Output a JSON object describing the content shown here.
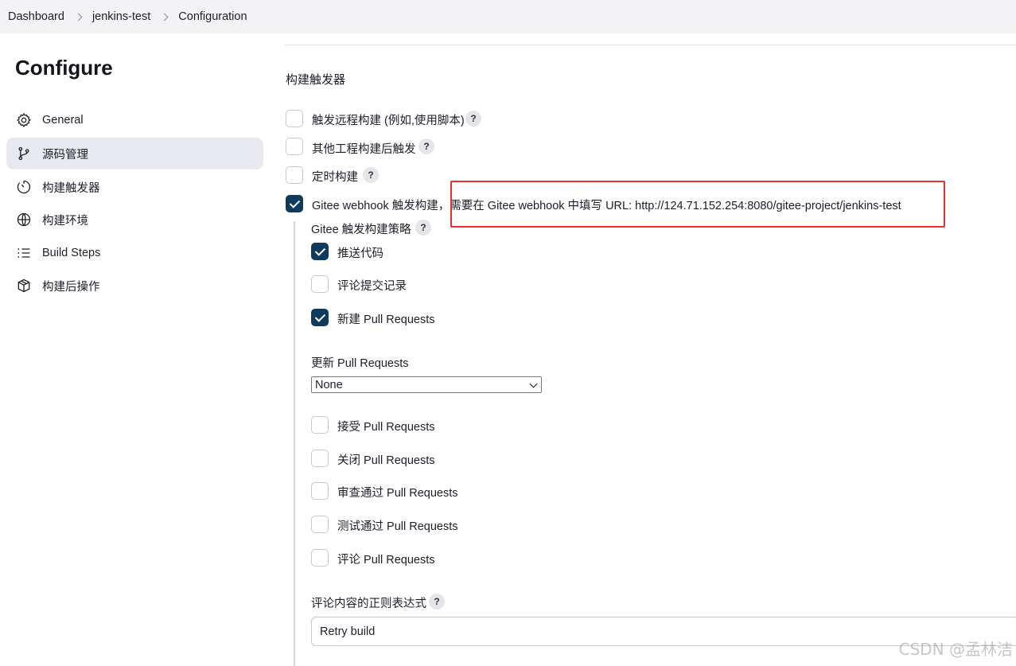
{
  "breadcrumb": {
    "items": [
      "Dashboard",
      "jenkins-test",
      "Configuration"
    ]
  },
  "sidebar": {
    "title": "Configure",
    "items": [
      {
        "label": "General",
        "icon": "gear-icon"
      },
      {
        "label": "源码管理",
        "icon": "branch-icon",
        "active": true
      },
      {
        "label": "构建触发器",
        "icon": "timer-icon"
      },
      {
        "label": "构建环境",
        "icon": "globe-icon"
      },
      {
        "label": "Build Steps",
        "icon": "list-icon"
      },
      {
        "label": "构建后操作",
        "icon": "box-icon"
      }
    ]
  },
  "main": {
    "section_title": "构建触发器",
    "triggers": [
      {
        "label": "触发远程构建 (例如,使用脚本)",
        "checked": false,
        "help": "?"
      },
      {
        "label": "其他工程构建后触发",
        "checked": false,
        "help": "?"
      },
      {
        "label": "定时构建",
        "checked": false,
        "help": "?"
      }
    ],
    "gitee": {
      "label": "Gitee webhook 触发构建，需要在 Gitee webhook 中填写 URL: http://124.71.152.254:8080/gitee-project/jenkins-test",
      "checked": true,
      "strategy_label": "Gitee 触发构建策略",
      "help": "?",
      "options": [
        {
          "label": "推送代码",
          "checked": true
        },
        {
          "label": "评论提交记录",
          "checked": false
        },
        {
          "label": "新建 Pull Requests",
          "checked": true
        }
      ],
      "update_pr_label": "更新 Pull Requests",
      "update_pr_value": "None",
      "pr_options": [
        {
          "label": "接受 Pull Requests",
          "checked": false
        },
        {
          "label": "关闭 Pull Requests",
          "checked": false
        },
        {
          "label": "审查通过 Pull Requests",
          "checked": false
        },
        {
          "label": "测试通过 Pull Requests",
          "checked": false
        },
        {
          "label": "评论 Pull Requests",
          "checked": false
        }
      ],
      "comment_regex_label": "评论内容的正则表达式",
      "comment_regex_value": "Retry build"
    }
  },
  "watermark": "CSDN @孟林洁",
  "colors": {
    "checkbox_checked": "#0f3a5c",
    "highlight_box": "#e8302a",
    "active_nav_bg": "#e9eaef"
  }
}
